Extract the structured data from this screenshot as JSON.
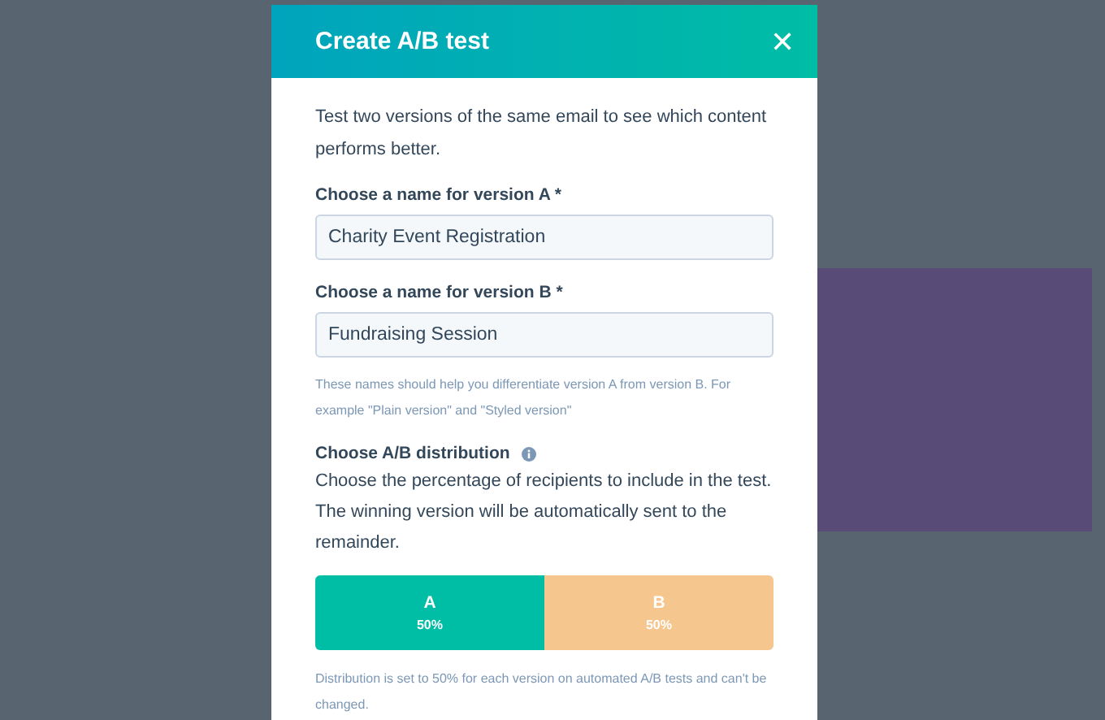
{
  "dialog": {
    "title": "Create A/B test",
    "close_glyph": "✕",
    "intro": "Test two versions of the same email to see which content performs better.",
    "fields": [
      {
        "label": "Choose a name for version A *",
        "value": "Charity Event Registration"
      },
      {
        "label": "Choose a name for version B *",
        "value": "Fundraising Session"
      }
    ],
    "fields_help": "These names should help you differentiate version A from version B. For example \"Plain version\" and \"Styled version\"",
    "distribution": {
      "label": "Choose A/B distribution",
      "description": "Choose the percentage of recipients to include in the test. The winning version will be automatically sent to the remainder.",
      "segments": [
        {
          "name": "A",
          "percent": "50%",
          "color": "#00bda5"
        },
        {
          "name": "B",
          "percent": "50%",
          "color": "#f5c78e"
        }
      ],
      "note": "Distribution is set to 50% for each version on automated A/B tests and can't be changed."
    }
  }
}
